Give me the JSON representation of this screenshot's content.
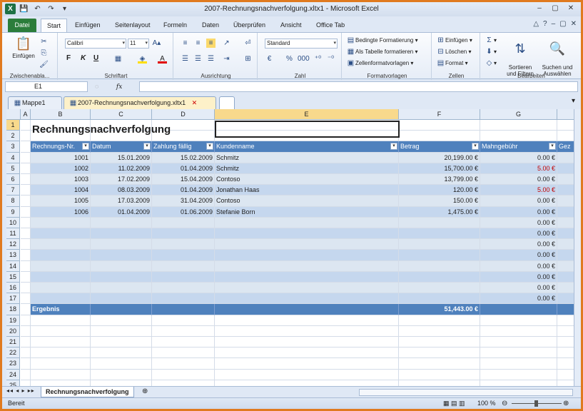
{
  "window": {
    "title": "2007-Rechnungsnachverfolgung.xltx1 - Microsoft Excel"
  },
  "ribbon_tabs": [
    "Datei",
    "Start",
    "Einfügen",
    "Seitenlayout",
    "Formeln",
    "Daten",
    "Überprüfen",
    "Ansicht",
    "Office Tab"
  ],
  "ribbon": {
    "paste": "Einfügen",
    "clipboard_label": "Zwischenabla...",
    "font_name": "Calibri",
    "font_size": "11",
    "font_group_label": "Schriftart",
    "bold": "F",
    "italic": "K",
    "underline": "U",
    "alignment_label": "Ausrichtung",
    "number_format": "Standard",
    "number_label": "Zahl",
    "cond_format": "Bedingte Formatierung",
    "as_table": "Als Tabelle formatieren",
    "cell_styles": "Zellenformatvorlagen",
    "styles_label": "Formatvorlagen",
    "insert": "Einfügen",
    "delete": "Löschen",
    "format": "Format",
    "cells_label": "Zellen",
    "sort_filter": "Sortieren\nund Filtern",
    "find_select": "Suchen und\nAuswählen",
    "edit_label": "Bearbeiten"
  },
  "formula_bar": {
    "name_box": "E1",
    "fx": "fx",
    "value": ""
  },
  "doc_tabs": [
    "Mappe1",
    "2007-Rechnungsnachverfolgung.xltx1"
  ],
  "columns": [
    "A",
    "B",
    "C",
    "D",
    "E",
    "F",
    "G"
  ],
  "sheet": {
    "title": "Rechnungsnachverfolgung",
    "headers": [
      "Rechnungs-Nr.",
      "Datum",
      "Zahlung fällig",
      "Kundenname",
      "Betrag",
      "Mahngebühr",
      "Gez"
    ],
    "rows": [
      [
        "1001",
        "15.01.2009",
        "15.02.2009",
        "Schmitz",
        "20,199.00 €",
        "0.00 €"
      ],
      [
        "1002",
        "11.02.2009",
        "01.04.2009",
        "Schmitz",
        "15,700.00 €",
        "5.00 €"
      ],
      [
        "1003",
        "17.02.2009",
        "15.04.2009",
        "Contoso",
        "13,799.00 €",
        "0.00 €"
      ],
      [
        "1004",
        "08.03.2009",
        "01.04.2009",
        "Jonathan Haas",
        "120.00 €",
        "5.00 €"
      ],
      [
        "1005",
        "17.03.2009",
        "31.04.2009",
        "Contoso",
        "150.00 €",
        "0.00 €"
      ],
      [
        "1006",
        "01.04.2009",
        "01.06.2009",
        "Stefanie Born",
        "1,475.00 €",
        "0.00 €"
      ],
      [
        "",
        "",
        "",
        "",
        "",
        "0.00 €"
      ],
      [
        "",
        "",
        "",
        "",
        "",
        "0.00 €"
      ],
      [
        "",
        "",
        "",
        "",
        "",
        "0.00 €"
      ],
      [
        "",
        "",
        "",
        "",
        "",
        "0.00 €"
      ],
      [
        "",
        "",
        "",
        "",
        "",
        "0.00 €"
      ],
      [
        "",
        "",
        "",
        "",
        "",
        "0.00 €"
      ],
      [
        "",
        "",
        "",
        "",
        "",
        "0.00 €"
      ],
      [
        "",
        "",
        "",
        "",
        "",
        "0.00 €"
      ]
    ],
    "negative_rows": [
      1,
      3
    ],
    "total_label": "Ergebnis",
    "total_value": "51,443.00 €"
  },
  "sheet_tab": "Rechnungsnachverfolgung",
  "status": {
    "ready": "Bereit",
    "zoom": "100 %"
  }
}
